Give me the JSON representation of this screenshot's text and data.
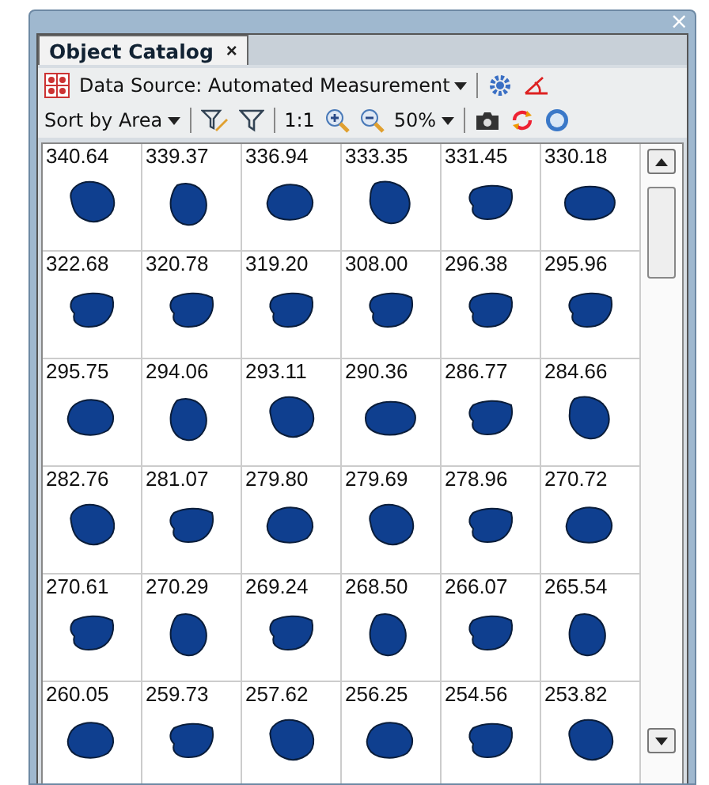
{
  "window": {
    "close": "×"
  },
  "tabs": [
    {
      "label": "Object Catalog",
      "close": "×",
      "selected": true
    }
  ],
  "toolbar": {
    "data_source": "Data Source: Automated Measurement",
    "sort": "Sort by Area",
    "actual_size": "1:1",
    "zoom": "50%"
  },
  "catalog": {
    "rows": [
      [
        "340.64",
        "339.37",
        "336.94",
        "333.35",
        "331.45",
        "330.18"
      ],
      [
        "322.68",
        "320.78",
        "319.20",
        "308.00",
        "296.38",
        "295.96"
      ],
      [
        "295.75",
        "294.06",
        "293.11",
        "290.36",
        "286.77",
        "284.66"
      ],
      [
        "282.76",
        "281.07",
        "279.80",
        "279.69",
        "278.96",
        "270.72"
      ],
      [
        "270.61",
        "270.29",
        "269.24",
        "268.50",
        "266.07",
        "265.54"
      ],
      [
        "260.05",
        "259.73",
        "257.62",
        "256.25",
        "254.56",
        "253.82"
      ]
    ]
  }
}
